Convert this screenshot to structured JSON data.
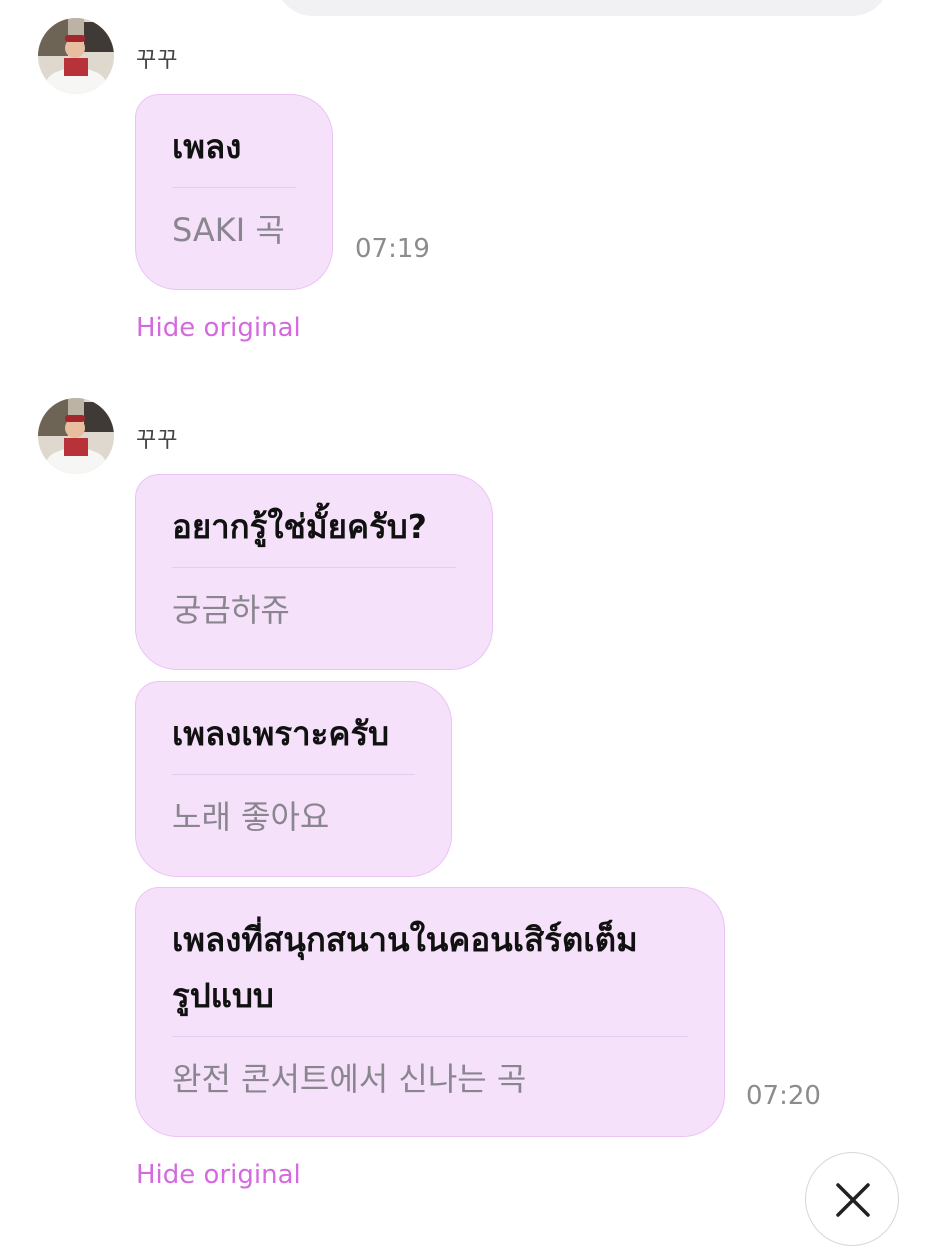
{
  "chat": {
    "groups": [
      {
        "sender": "꾸꾸",
        "messages": [
          {
            "text": "เพลง",
            "translation": "SAKI 곡",
            "time": "07:19"
          }
        ],
        "hide_label": "Hide original"
      },
      {
        "sender": "꾸꾸",
        "messages": [
          {
            "text": "อยากรู้ใช่มั้ยครับ?",
            "translation": "궁금하쥬"
          },
          {
            "text": "เพลงเพราะครับ",
            "translation": "노래 좋아요"
          },
          {
            "text_line1": "เพลงที่สนุกสนานในคอนเสิร์ตเต็ม",
            "text_line2": "รูปแบบ",
            "translation": "완전 콘서트에서 신나는 곡",
            "time": "07:20"
          }
        ],
        "hide_label": "Hide original"
      }
    ]
  },
  "icons": {
    "avatar": "avatar-photo",
    "close": "close-icon"
  },
  "colors": {
    "bubble_bg": "#f6e1fb",
    "bubble_border": "#ebc3f5",
    "link": "#d56ae0",
    "time": "#8c8c8c"
  }
}
